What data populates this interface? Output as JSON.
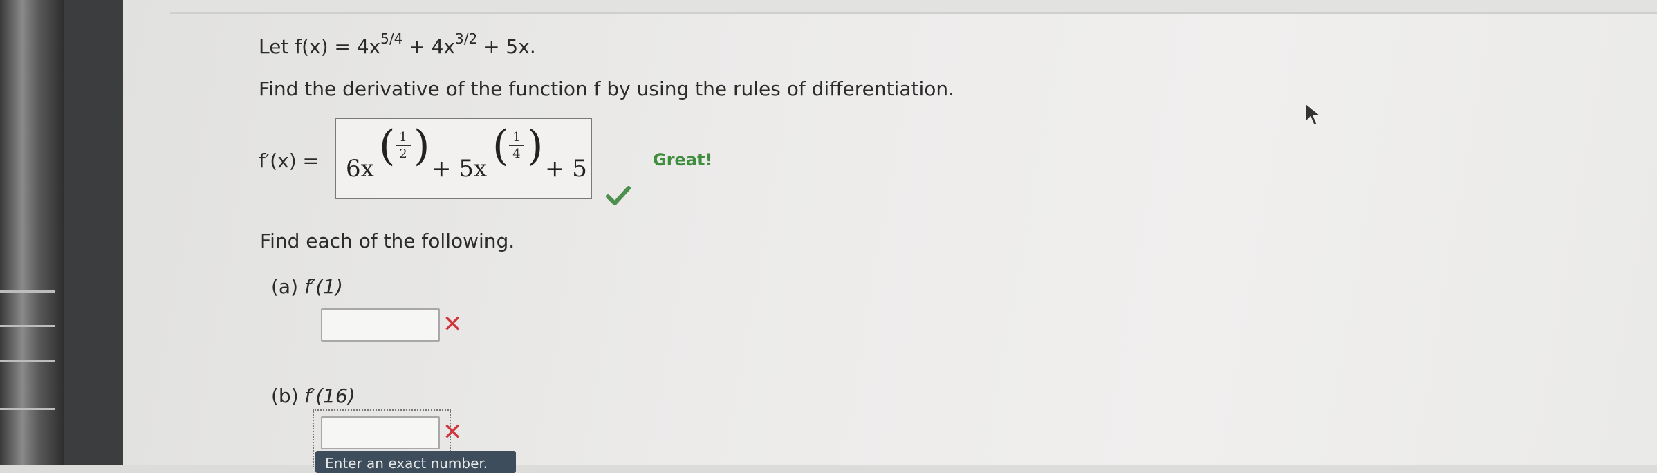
{
  "problem": {
    "intro_prefix": "Let ",
    "intro_func": "f(x) = 4x",
    "exp1": "5/4",
    "mid": " + 4x",
    "exp2": "3/2",
    "tail": " + 5x.",
    "instruction": "Find the derivative of the function f by using the rules of differentiation.",
    "derivative_label": "f′(x) ="
  },
  "answer": {
    "term1": "6x",
    "frac1_num": "1",
    "frac1_den": "2",
    "term2": "+ 5x",
    "frac2_num": "1",
    "frac2_den": "4",
    "term3": "+ 5",
    "feedback": "Great!"
  },
  "parts": {
    "heading": "Find each of the following.",
    "a_label": "(a)",
    "a_expr": "f′(1)",
    "a_value": "",
    "b_label": "(b)",
    "b_expr": "f′(16)",
    "b_value": "",
    "tooltip": "Enter an exact number."
  },
  "colors": {
    "correct": "#3e8e3e",
    "incorrect": "#d0373c",
    "tooltip_bg": "#3d4d5c"
  },
  "icons": [
    "check-icon",
    "x-icon",
    "mouse-pointer-icon"
  ]
}
